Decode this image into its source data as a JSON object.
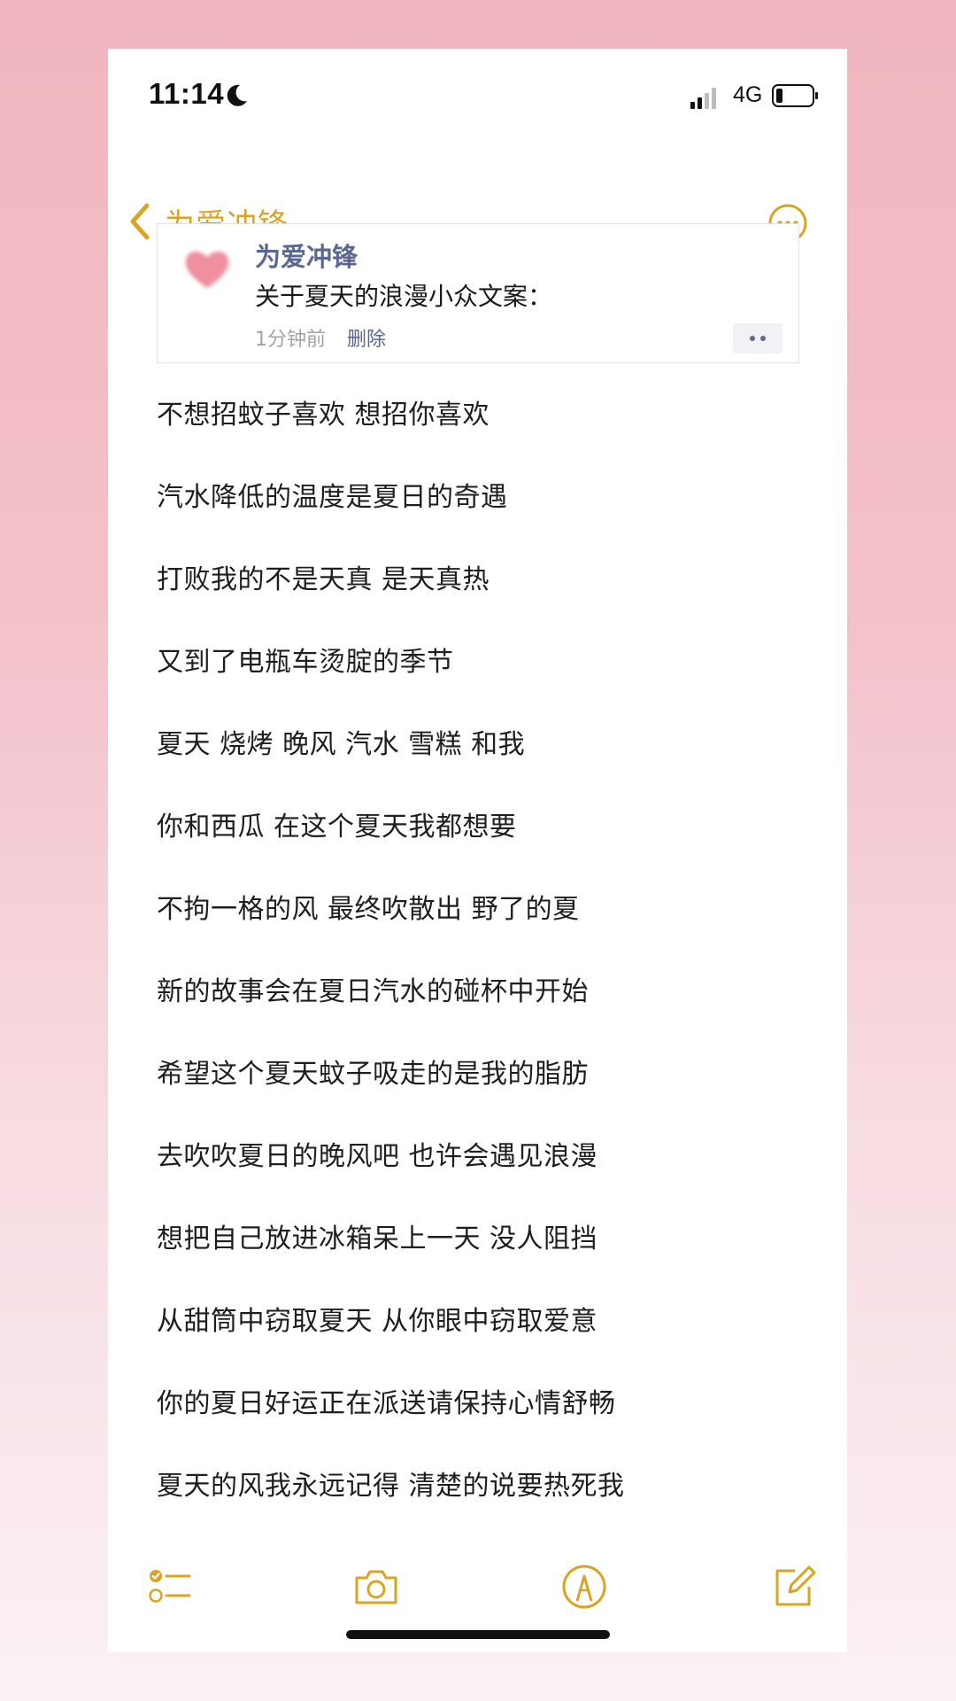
{
  "status_bar": {
    "time": "11:14",
    "network": "4G"
  },
  "nav": {
    "back_label": "为爱冲锋"
  },
  "share_card": {
    "title": "为爱冲锋",
    "text": "关于夏天的浪漫小众文案：",
    "time_ago": "1分钟前",
    "delete_label": "删除"
  },
  "note_lines": [
    "不想招蚊子喜欢 想招你喜欢",
    "汽水降低的温度是夏日的奇遇",
    "打败我的不是天真 是天真热",
    "又到了电瓶车烫腚的季节",
    "夏天 烧烤 晚风 汽水 雪糕 和我",
    "你和西瓜 在这个夏天我都想要",
    "不拘一格的风 最终吹散出 野了的夏",
    "新的故事会在夏日汽水的碰杯中开始",
    "希望这个夏天蚊子吸走的是我的脂肪",
    "去吹吹夏日的晚风吧 也许会遇见浪漫",
    "想把自己放进冰箱呆上一天 没人阻挡",
    "从甜筒中窃取夏天 从你眼中窃取爱意",
    "你的夏日好运正在派送请保持心情舒畅",
    "夏天的风我永远记得 清楚的说要热死我"
  ],
  "icons": {
    "status": [
      "moon-icon",
      "signal-icon",
      "battery-icon"
    ],
    "nav": [
      "chevron-left-icon",
      "more-circle-icon"
    ],
    "toolbar": [
      "checklist-icon",
      "camera-icon",
      "markup-pen-icon",
      "compose-icon"
    ]
  },
  "colors": {
    "accent": "#d9a421",
    "link": "#5a6790",
    "background_top": "#f1b6bf",
    "background_bottom": "#fbf1f3"
  }
}
